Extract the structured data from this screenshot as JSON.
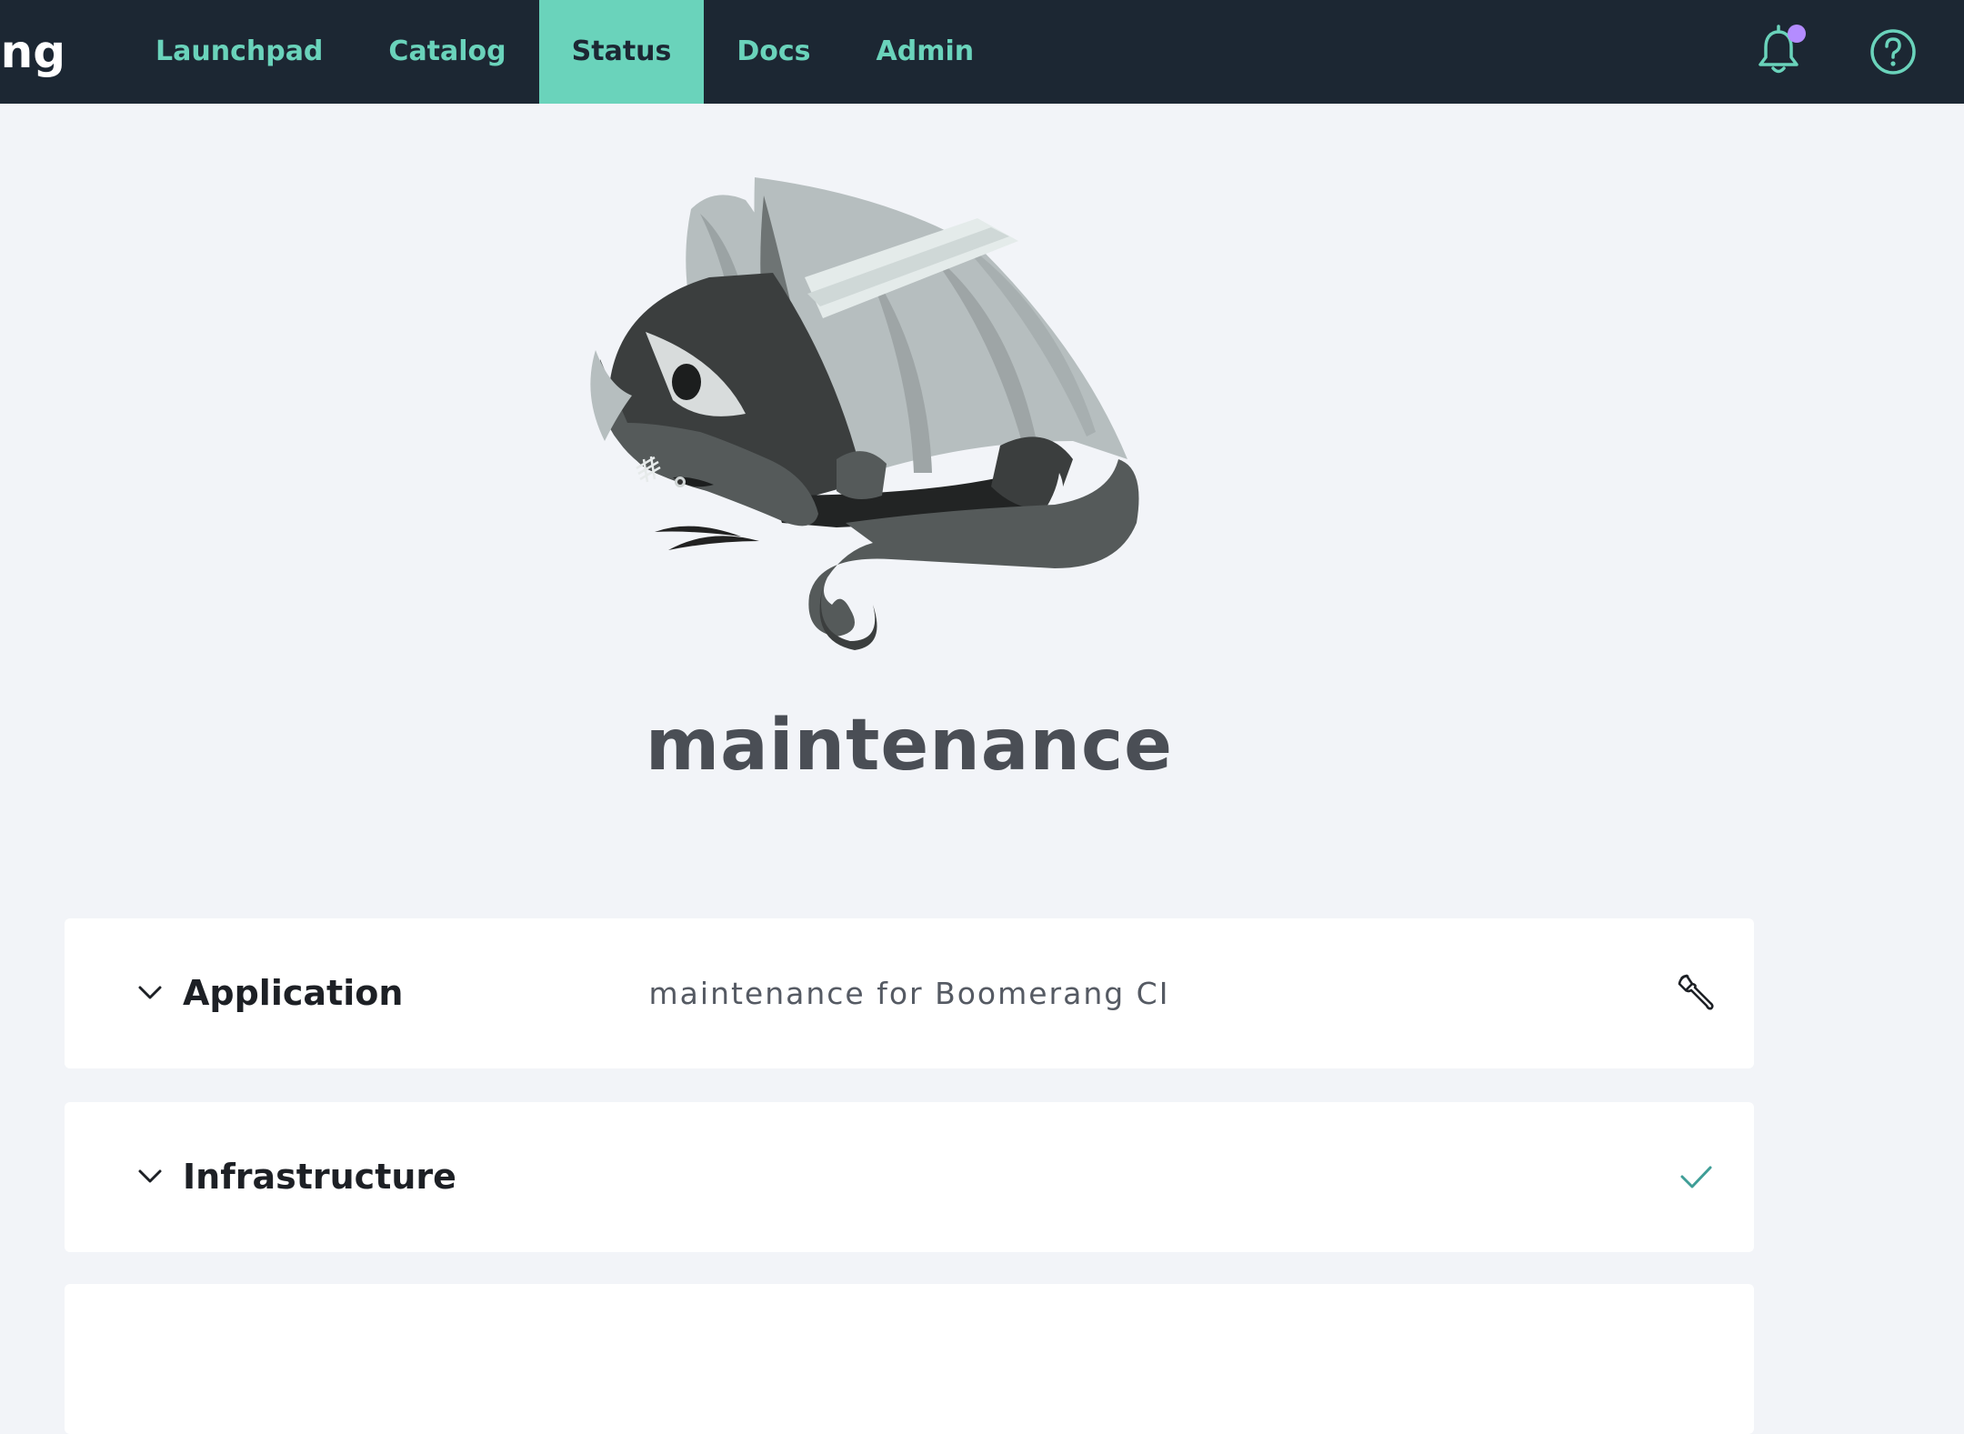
{
  "header": {
    "brand": "Boomerang",
    "nav": [
      {
        "label": "Launchpad",
        "active": false
      },
      {
        "label": "Catalog",
        "active": false
      },
      {
        "label": "Status",
        "active": true
      },
      {
        "label": "Docs",
        "active": false
      },
      {
        "label": "Admin",
        "active": false
      }
    ],
    "icons": [
      "bell-icon",
      "help-icon"
    ],
    "notification_indicator": true
  },
  "hero": {
    "illustration": "sleeping-dragon-with-bandaged-wing",
    "title": "maintenance"
  },
  "panels": [
    {
      "title": "Application",
      "description": "maintenance for Boomerang CI",
      "status_icon": "wrench-icon",
      "status_color": "#1d2025"
    },
    {
      "title": "Infrastructure",
      "description": "",
      "status_icon": "checkmark-icon",
      "status_color": "#3f9e97"
    }
  ],
  "colors": {
    "nav_background": "#1c2733",
    "accent": "#6ad3bb",
    "notification_dot": "#b48cff",
    "page_background": "#f2f4f8"
  }
}
